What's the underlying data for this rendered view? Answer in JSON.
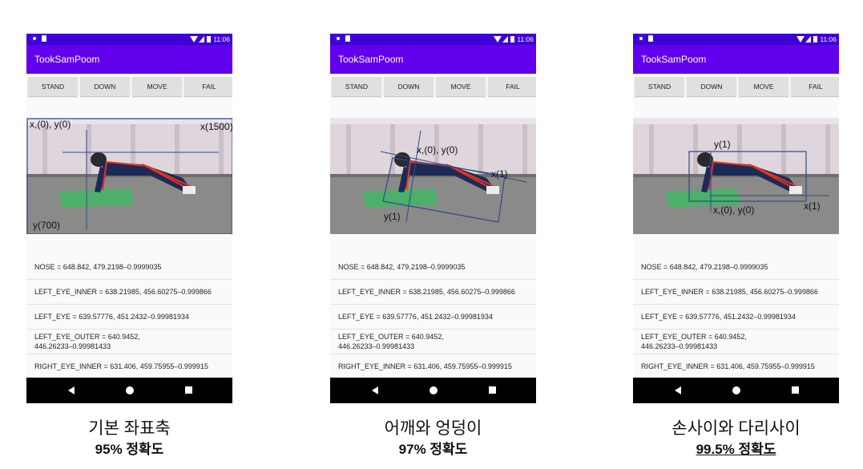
{
  "panels": [
    {
      "status_time": "11:06",
      "app_title": "TookSamPoom",
      "buttons": [
        "STAND",
        "DOWN",
        "MOVE",
        "FAIL"
      ],
      "annotations": {
        "origin": "x,(0), y(0)",
        "xlabel": "x(1500)",
        "ylabel": "y(700)"
      },
      "rows": [
        "NOSE = 648.842, 479.2198–0.9999035",
        "LEFT_EYE_INNER = 638.21985, 456.60275–0.999866",
        "LEFT_EYE = 639.57776, 451.2432–0.99981934",
        "LEFT_EYE_OUTER = 640.9452,",
        "446.26233–0.99981433",
        "RIGHT_EYE_INNER = 631.406, 459.75955–0.999915"
      ],
      "caption_title": "기본 좌표축",
      "caption_accuracy": "95% 정확도"
    },
    {
      "status_time": "11:06",
      "app_title": "TookSamPoom",
      "buttons": [
        "STAND",
        "DOWN",
        "MOVE",
        "FAIL"
      ],
      "annotations": {
        "origin": "x,(0), y(0)",
        "xlabel": "x(1)",
        "ylabel": "y(1)"
      },
      "rows": [
        "NOSE = 648.842, 479.2198–0.9999035",
        "LEFT_EYE_INNER = 638.21985, 456.60275–0.999866",
        "LEFT_EYE = 639.57776, 451.2432–0.99981934",
        "LEFT_EYE_OUTER = 640.9452,",
        "446.26233–0.99981433",
        "RIGHT_EYE_INNER = 631.406, 459.75955–0.999915"
      ],
      "caption_title": "어깨와 엉덩이",
      "caption_accuracy": "97% 정확도"
    },
    {
      "status_time": "11:06",
      "app_title": "TookSamPoom",
      "buttons": [
        "STAND",
        "DOWN",
        "MOVE",
        "FAIL"
      ],
      "annotations": {
        "origin": "x,(0), y(0)",
        "xlabel": "x(1)",
        "ylabel": "y(1)"
      },
      "rows": [
        "NOSE = 648.842, 479.2198–0.9999035",
        "LEFT_EYE_INNER = 638.21985, 456.60275–0.999866",
        "LEFT_EYE = 639.57776, 451.2432–0.99981934",
        "LEFT_EYE_OUTER = 640.9452,",
        "446.26233–0.99981433",
        "RIGHT_EYE_INNER = 631.406, 459.75955–0.999915"
      ],
      "caption_title": "손사이와 다리사이",
      "caption_accuracy": "99.5% 정확도"
    }
  ],
  "colors": {
    "status_bar": "#3f00d6",
    "app_bar": "#6200ee",
    "axis_line": "#2f4a8c",
    "skeleton": "#e8321e"
  }
}
